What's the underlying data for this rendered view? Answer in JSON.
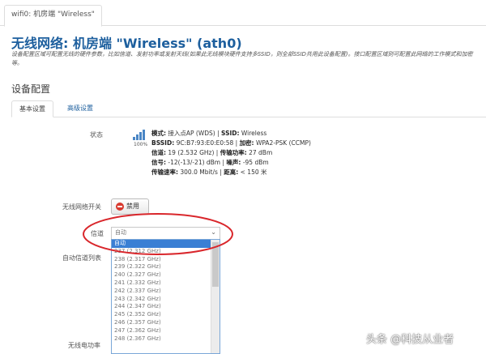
{
  "window": {
    "tab_label": "wifi0: 机房端 \"Wireless\""
  },
  "page": {
    "title": "无线网络: 机房端 \"Wireless\" (ath0)",
    "description": "设备配置区域可配置无线的硬件参数，比如信道、发射功率或发射天线(如果此无线模块硬件支持多SSID，则全部SSID共用此设备配置)。接口配置区域则可配置此网络的工作模式和加密等。"
  },
  "section": {
    "title": "设备配置"
  },
  "tabs": [
    {
      "label": "基本设置",
      "active": true
    },
    {
      "label": "高级设置",
      "active": false
    }
  ],
  "form": {
    "status_label": "状态",
    "signal_percent": "100%",
    "status": {
      "line1": {
        "k1": "模式:",
        "v1": "接入点AP (WDS)",
        "k2": "SSID:",
        "v2": "Wireless"
      },
      "line2": {
        "k1": "BSSID:",
        "v1": "9C:B7:93:E0:E0:58",
        "k2": "加密:",
        "v2": "WPA2-PSK (CCMP)"
      },
      "line3": {
        "k1": "信道:",
        "v1": "19 (2.532 GHz)",
        "k2": "传输功率:",
        "v2": "27 dBm"
      },
      "line4": {
        "k1": "信号:",
        "v1": "-12(-13/-21) dBm",
        "k2": "噪声:",
        "v2": "-95 dBm"
      },
      "line5": {
        "k1": "传输速率:",
        "v1": "300.0 Mbit/s",
        "k2": "距离:",
        "v2": "< 150 米"
      }
    },
    "wireless_switch_label": "无线网络开关",
    "disable_button": "禁用",
    "channel_label": "信道",
    "channel_value": "自动",
    "auto_channel_label": "自动信道列表",
    "tx_power_label": "无线电功率",
    "channel_options": [
      "自动",
      "237 (2.312 GHz)",
      "238 (2.317 GHz)",
      "239 (2.322 GHz)",
      "240 (2.327 GHz)",
      "241 (2.332 GHz)",
      "242 (2.337 GHz)",
      "243 (2.342 GHz)",
      "244 (2.347 GHz)",
      "245 (2.352 GHz)",
      "246 (2.357 GHz)",
      "247 (2.362 GHz)",
      "248 (2.367 GHz)"
    ]
  },
  "watermark": "头条 @科技从业者",
  "colors": {
    "title_blue": "#1d5f9e",
    "selected_blue": "#3a7fd4",
    "highlight_red": "#d9262b",
    "disable_red": "#d83a2f"
  }
}
